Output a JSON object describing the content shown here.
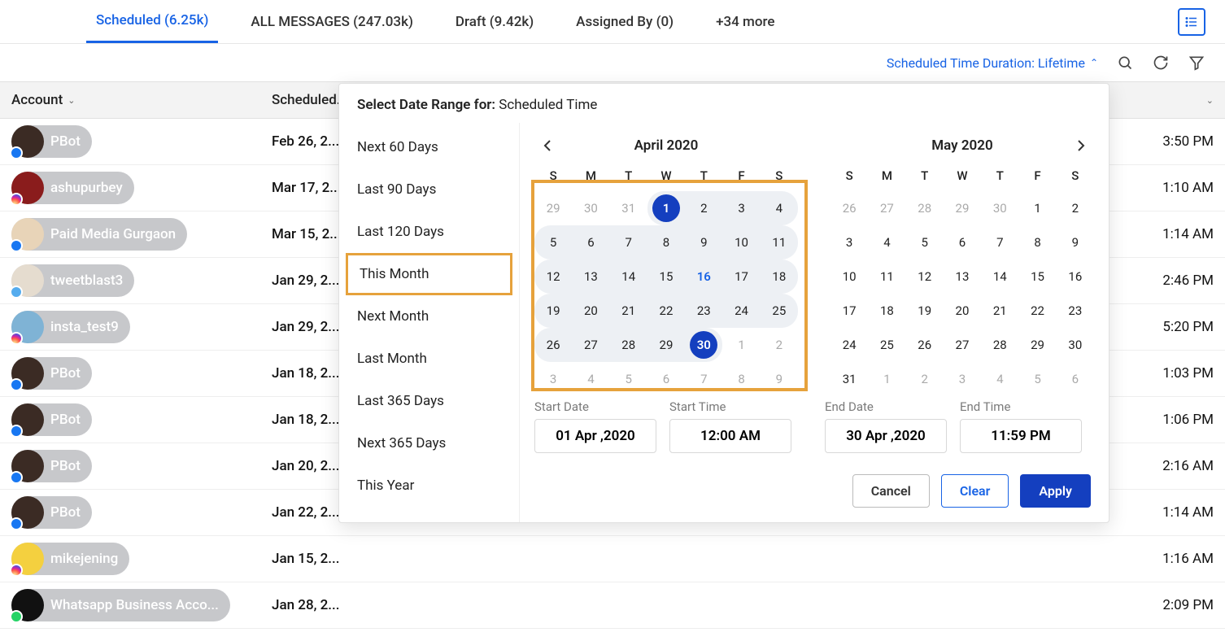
{
  "tabs": [
    {
      "label": "Scheduled (6.25k)",
      "active": true
    },
    {
      "label": "ALL MESSAGES (247.03k)"
    },
    {
      "label": "Draft (9.42k)"
    },
    {
      "label": "Assigned By (0)"
    },
    {
      "label": "+34 more"
    }
  ],
  "filter_label": "Scheduled Time Duration: Lifetime",
  "columns": {
    "account": "Account",
    "scheduled": "Scheduled..."
  },
  "rows": [
    {
      "name": "PBot",
      "badge": "fb",
      "avatar_bg": "#3b2b24",
      "date": "Feb 26, 2...",
      "time": "3:50 PM"
    },
    {
      "name": "ashupurbey",
      "badge": "ig",
      "avatar_bg": "#8a1c1c",
      "date": "Mar 17, 2...",
      "time": "1:10 AM"
    },
    {
      "name": "Paid Media Gurgaon",
      "badge": "fb",
      "avatar_bg": "#e8d4b8",
      "date": "Mar 15, 2...",
      "time": "1:14 AM"
    },
    {
      "name": "tweetblast3",
      "badge": "tw",
      "avatar_bg": "#e5dccf",
      "date": "Jan 29, 2...",
      "time": "2:46 PM"
    },
    {
      "name": "insta_test9",
      "badge": "ig",
      "avatar_bg": "#7fb3d5",
      "date": "Jan 29, 2...",
      "time": "5:20 PM"
    },
    {
      "name": "PBot",
      "badge": "fb",
      "avatar_bg": "#3b2b24",
      "date": "Jan 18, 2...",
      "time": "1:03 PM"
    },
    {
      "name": "PBot",
      "badge": "fb",
      "avatar_bg": "#3b2b24",
      "date": "Jan 18, 2...",
      "time": "1:06 PM"
    },
    {
      "name": "PBot",
      "badge": "fb",
      "avatar_bg": "#3b2b24",
      "date": "Jan 20, 2...",
      "time": "2:16 AM"
    },
    {
      "name": "PBot",
      "badge": "fb",
      "avatar_bg": "#3b2b24",
      "date": "Jan 22, 2...",
      "time": "1:14 AM"
    },
    {
      "name": "mikejening",
      "badge": "ig",
      "avatar_bg": "#f4d03f",
      "date": "Jan 15, 2...",
      "time": "1:16 AM"
    },
    {
      "name": "Whatsapp Business Acco...",
      "badge": "wa",
      "avatar_bg": "#111",
      "date": "Jan 28, 2...",
      "time": "2:09 PM"
    }
  ],
  "dp": {
    "title_prefix": "Select Date Range for:",
    "title_field": "Scheduled Time",
    "presets": [
      "Next 60 Days",
      "Last 90 Days",
      "Last 120 Days",
      "This Month",
      "Next Month",
      "Last Month",
      "Last 365 Days",
      "Next 365 Days",
      "This Year"
    ],
    "highlight_preset": "This Month",
    "dow": [
      "S",
      "M",
      "T",
      "W",
      "T",
      "F",
      "S"
    ],
    "cal_left": {
      "title": "April 2020",
      "weeks": [
        [
          {
            "n": 29,
            "m": 1
          },
          {
            "n": 30,
            "m": 1
          },
          {
            "n": 31,
            "m": 1
          },
          {
            "n": 1,
            "r": 1,
            "e": 1,
            "rs": 1
          },
          {
            "n": 2,
            "r": 1
          },
          {
            "n": 3,
            "r": 1
          },
          {
            "n": 4,
            "r": 1,
            "re": 1
          }
        ],
        [
          {
            "n": 5,
            "r": 1,
            "rs": 1
          },
          {
            "n": 6,
            "r": 1
          },
          {
            "n": 7,
            "r": 1
          },
          {
            "n": 8,
            "r": 1
          },
          {
            "n": 9,
            "r": 1
          },
          {
            "n": 10,
            "r": 1
          },
          {
            "n": 11,
            "r": 1,
            "re": 1
          }
        ],
        [
          {
            "n": 12,
            "r": 1,
            "rs": 1
          },
          {
            "n": 13,
            "r": 1
          },
          {
            "n": 14,
            "r": 1
          },
          {
            "n": 15,
            "r": 1
          },
          {
            "n": 16,
            "r": 1,
            "t": 1
          },
          {
            "n": 17,
            "r": 1
          },
          {
            "n": 18,
            "r": 1,
            "re": 1
          }
        ],
        [
          {
            "n": 19,
            "r": 1,
            "rs": 1
          },
          {
            "n": 20,
            "r": 1
          },
          {
            "n": 21,
            "r": 1
          },
          {
            "n": 22,
            "r": 1
          },
          {
            "n": 23,
            "r": 1
          },
          {
            "n": 24,
            "r": 1
          },
          {
            "n": 25,
            "r": 1,
            "re": 1
          }
        ],
        [
          {
            "n": 26,
            "r": 1,
            "rs": 1
          },
          {
            "n": 27,
            "r": 1
          },
          {
            "n": 28,
            "r": 1
          },
          {
            "n": 29,
            "r": 1
          },
          {
            "n": 30,
            "r": 1,
            "e": 1,
            "re": 1
          },
          {
            "n": 1,
            "m": 1
          },
          {
            "n": 2,
            "m": 1
          }
        ],
        [
          {
            "n": 3,
            "m": 1
          },
          {
            "n": 4,
            "m": 1
          },
          {
            "n": 5,
            "m": 1
          },
          {
            "n": 6,
            "m": 1
          },
          {
            "n": 7,
            "m": 1
          },
          {
            "n": 8,
            "m": 1
          },
          {
            "n": 9,
            "m": 1
          }
        ]
      ]
    },
    "cal_right": {
      "title": "May 2020",
      "weeks": [
        [
          {
            "n": 26,
            "m": 1
          },
          {
            "n": 27,
            "m": 1
          },
          {
            "n": 28,
            "m": 1
          },
          {
            "n": 29,
            "m": 1
          },
          {
            "n": 30,
            "m": 1
          },
          {
            "n": 1
          },
          {
            "n": 2
          }
        ],
        [
          {
            "n": 3
          },
          {
            "n": 4
          },
          {
            "n": 5
          },
          {
            "n": 6
          },
          {
            "n": 7
          },
          {
            "n": 8
          },
          {
            "n": 9
          }
        ],
        [
          {
            "n": 10
          },
          {
            "n": 11
          },
          {
            "n": 12
          },
          {
            "n": 13
          },
          {
            "n": 14
          },
          {
            "n": 15
          },
          {
            "n": 16
          }
        ],
        [
          {
            "n": 17
          },
          {
            "n": 18
          },
          {
            "n": 19
          },
          {
            "n": 20
          },
          {
            "n": 21
          },
          {
            "n": 22
          },
          {
            "n": 23
          }
        ],
        [
          {
            "n": 24
          },
          {
            "n": 25
          },
          {
            "n": 26
          },
          {
            "n": 27
          },
          {
            "n": 28
          },
          {
            "n": 29
          },
          {
            "n": 30
          }
        ],
        [
          {
            "n": 31
          },
          {
            "n": 1,
            "m": 1
          },
          {
            "n": 2,
            "m": 1
          },
          {
            "n": 3,
            "m": 1
          },
          {
            "n": 4,
            "m": 1
          },
          {
            "n": 5,
            "m": 1
          },
          {
            "n": 6,
            "m": 1
          }
        ]
      ]
    },
    "fields": {
      "start_date_label": "Start Date",
      "start_date": "01 Apr ,2020",
      "start_time_label": "Start Time",
      "start_time": "12:00 AM",
      "end_date_label": "End Date",
      "end_date": "30 Apr ,2020",
      "end_time_label": "End Time",
      "end_time": "11:59 PM"
    },
    "buttons": {
      "cancel": "Cancel",
      "clear": "Clear",
      "apply": "Apply"
    }
  }
}
